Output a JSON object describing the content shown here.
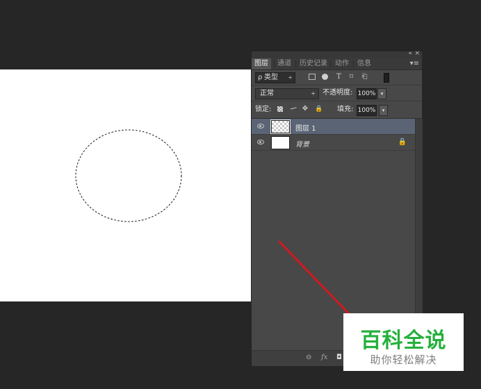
{
  "panel": {
    "collapse_icon": "«",
    "close_icon": "×",
    "menu_icon": "▾≡",
    "tabs": [
      {
        "label": "图层",
        "active": true
      },
      {
        "label": "通道",
        "active": false
      },
      {
        "label": "历史记录",
        "active": false
      },
      {
        "label": "动作",
        "active": false
      },
      {
        "label": "信息",
        "active": false
      }
    ],
    "filter": {
      "magnifier": "ρ",
      "kind_label": "类型",
      "arrows": "÷",
      "icons": [
        "image-filter-icon",
        "adjustment-filter-icon",
        "type-filter-icon",
        "shape-filter-icon",
        "smart-object-filter-icon"
      ],
      "type_glyph": "T",
      "shape_glyph": "⌑",
      "smart_glyph": "⎗"
    },
    "blend": {
      "mode": "正常",
      "arrows": "÷",
      "opacity_label": "不透明度:",
      "opacity_value": "100%",
      "dropdown": "▾"
    },
    "lock": {
      "label": "锁定:",
      "brush_glyph": "⁄",
      "move_glyph": "✥",
      "lock_glyph": "🔒",
      "fill_label": "填充:",
      "fill_value": "100%",
      "dropdown": "▾"
    },
    "layers": [
      {
        "name": "图层 1",
        "selected": true,
        "thumbnail": "transparent",
        "locked": false
      },
      {
        "name": "背景",
        "selected": false,
        "thumbnail": "white",
        "locked": true,
        "lock_glyph": "🔒"
      }
    ],
    "bottom": {
      "link_glyph": "⊖",
      "fx_label": "fx",
      "mask_glyph": "◘"
    }
  },
  "watermark": {
    "title": "百科全说",
    "subtitle": "助你轻松解决",
    "title_color": "#25b03c"
  },
  "colors": {
    "workspace": "#262626",
    "panel": "#484848",
    "selected_layer": "#5a6475",
    "arrow": "#d0191f"
  }
}
